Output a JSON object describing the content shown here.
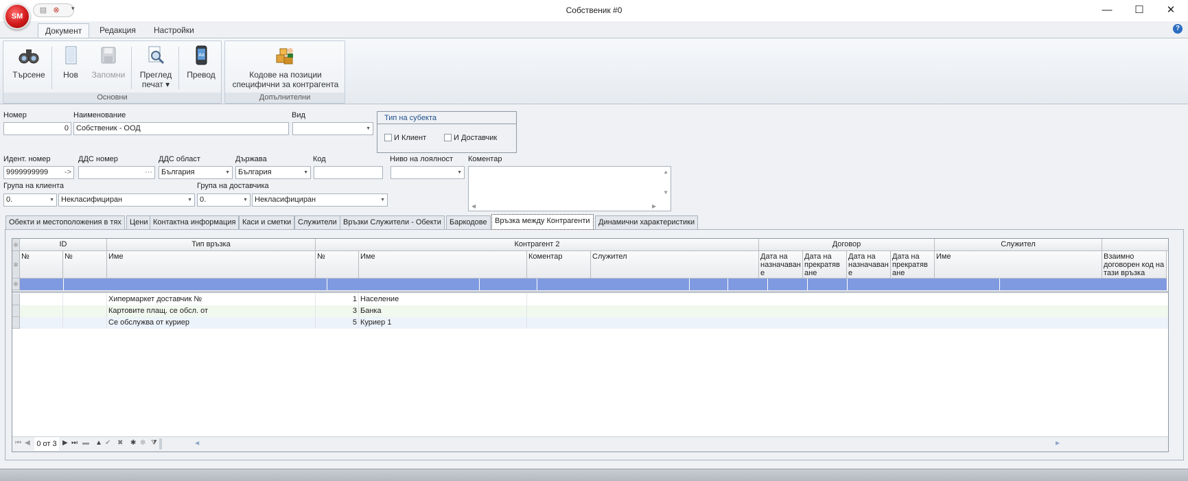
{
  "app": {
    "orb_label": "SM",
    "window_title": "Собственик #0"
  },
  "window_controls": {
    "minimize": "—",
    "maximize": "☐",
    "close": "✕"
  },
  "ribbon": {
    "tabs": [
      {
        "label": "Документ"
      },
      {
        "label": "Редакция"
      },
      {
        "label": "Настройки"
      }
    ],
    "help": "?",
    "groups": {
      "main": {
        "caption": "Основни",
        "buttons": {
          "search": "Търсене",
          "new": "Нов",
          "save": "Запомни",
          "preview_line1": "Преглед",
          "preview_line2": "печат ▾",
          "translate": "Превод"
        }
      },
      "extra": {
        "caption": "Допълнителни",
        "buttons": {
          "codes_line1": "Кодове на позиции",
          "codes_line2": "специфични за контрагента"
        }
      }
    }
  },
  "form": {
    "number": {
      "label": "Номер",
      "value": "0"
    },
    "name": {
      "label": "Наименование",
      "value": "Собственик - ООД"
    },
    "kind": {
      "label": "Вид",
      "value": ""
    },
    "subject_type": {
      "title": "Тип на субекта",
      "client": "И Клиент",
      "supplier": "И Доставчик"
    },
    "ident": {
      "label": "Идент. номер",
      "value": "9999999999",
      "btn": "->"
    },
    "vat_number": {
      "label": "ДДС номер",
      "value": "",
      "btn": "···"
    },
    "vat_region": {
      "label": "ДДС област",
      "value": "България"
    },
    "country": {
      "label": "Държава",
      "value": "България"
    },
    "code": {
      "label": "Код",
      "value": ""
    },
    "loyalty": {
      "label": "Ниво на лоялност",
      "value": ""
    },
    "comment": {
      "label": "Коментар",
      "value": ""
    },
    "client_group": {
      "label": "Група на клиента",
      "code": "0.",
      "value": "Некласифициран"
    },
    "supplier_group": {
      "label": "Група на доставчика",
      "code": "0.",
      "value": "Некласифициран"
    }
  },
  "tabs": [
    {
      "label": "Обекти и местоположения в тях"
    },
    {
      "label": "Цени"
    },
    {
      "label": "Контактна информация"
    },
    {
      "label": "Каси и сметки"
    },
    {
      "label": "Служители"
    },
    {
      "label": "Връзки Служители - Обекти"
    },
    {
      "label": "Баркодове"
    },
    {
      "label": "Връзка между Контрагенти"
    },
    {
      "label": "Динамични характеристики"
    }
  ],
  "grid": {
    "band_headers": {
      "id": "ID",
      "link_type": "Тип връзка",
      "counterparty2": "Контрагент 2",
      "contract": "Договор",
      "employee": "Служител"
    },
    "columns": {
      "id_no1": "№",
      "id_no2": "№",
      "link_name": "Име",
      "cp_no": "№",
      "cp_name": "Име",
      "cp_comment": "Коментар",
      "cp_employee": "Служител",
      "c_assign1": "Дата на назначаван е",
      "c_end1": "Дата на прекратяв ане",
      "c_assign2": "Дата на назначаван е",
      "c_end2": "Дата на прекратяв ане",
      "emp_name": "Име",
      "agreed_code": "Взаимно договорен код на тази връзка"
    },
    "rows": [
      {
        "link": "Хипермаркет доставчик №",
        "cp_no": "1",
        "cp_name": "Население"
      },
      {
        "link": "Картовите плащ. се обсл. от",
        "cp_no": "3",
        "cp_name": "Банка"
      },
      {
        "link": "Се обслужва от куриер",
        "cp_no": "5",
        "cp_name": "Куриер 1"
      }
    ],
    "navigator": {
      "record_text": "0 от 3"
    }
  },
  "colors": {
    "selected_row": "#7f9ae0",
    "accent": "#1f4e8c"
  }
}
